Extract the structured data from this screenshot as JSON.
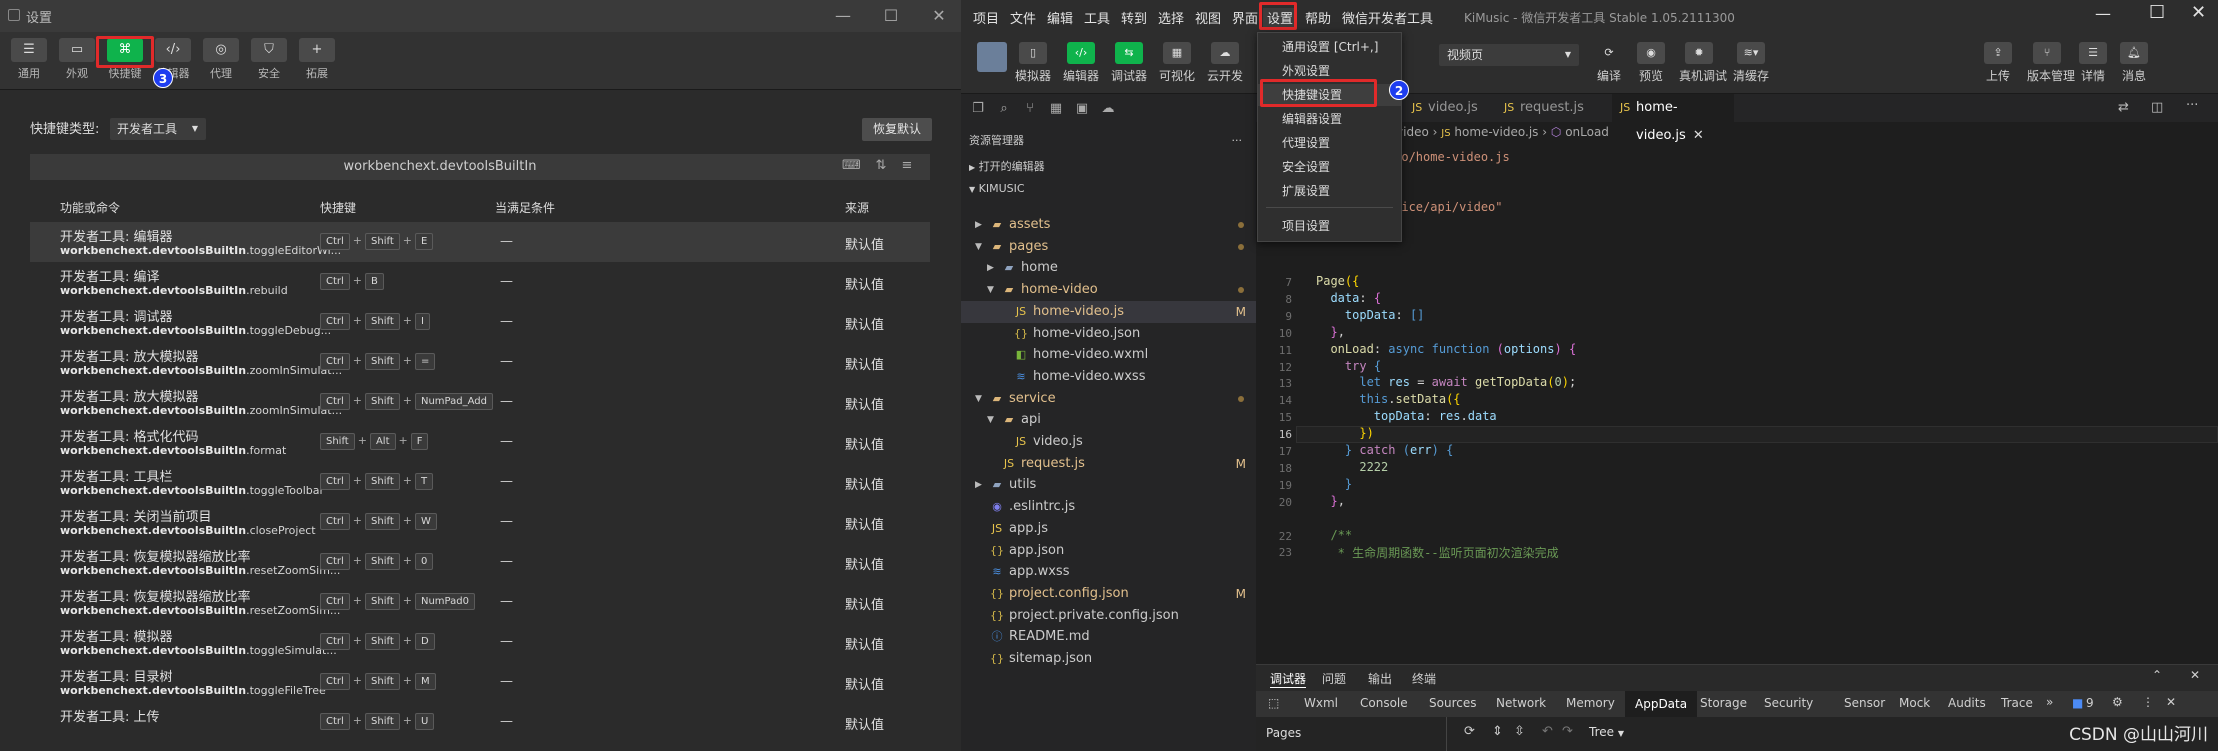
{
  "settings_window": {
    "title": "设置",
    "tabs": [
      {
        "label": "通用",
        "icon": "menu-icon"
      },
      {
        "label": "外观",
        "icon": "window-icon"
      },
      {
        "label": "快捷键",
        "icon": "command-key-icon"
      },
      {
        "label": "编辑器",
        "icon": "code-icon"
      },
      {
        "label": "代理",
        "icon": "globe-icon"
      },
      {
        "label": "安全",
        "icon": "shield-icon"
      },
      {
        "label": "拓展",
        "icon": "plus-icon"
      }
    ],
    "active_tab": "快捷键",
    "step_badge": "3",
    "shortcut_type_label": "快捷键类型:",
    "shortcut_type_value": "开发者工具",
    "restore_default": "恢复默认",
    "search_text": "workbenchext.devtoolsBuiltIn",
    "columns": [
      "功能或命令",
      "快捷键",
      "当满足条件",
      "来源"
    ],
    "rows": [
      {
        "name": "开发者工具: 编辑器",
        "cmd_bold": "workbenchext.devtoolsBuiltIn",
        "cmd_rest": ".toggleEditorWi...",
        "keys": [
          "Ctrl",
          "Shift",
          "E"
        ],
        "when": "—",
        "source": "默认值"
      },
      {
        "name": "开发者工具: 编译",
        "cmd_bold": "workbenchext.devtoolsBuiltIn",
        "cmd_rest": ".rebuild",
        "keys": [
          "Ctrl",
          "B"
        ],
        "when": "—",
        "source": "默认值"
      },
      {
        "name": "开发者工具: 调试器",
        "cmd_bold": "workbenchext.devtoolsBuiltIn",
        "cmd_rest": ".toggleDebug...",
        "keys": [
          "Ctrl",
          "Shift",
          "I"
        ],
        "when": "—",
        "source": "默认值"
      },
      {
        "name": "开发者工具: 放大模拟器",
        "cmd_bold": "workbenchext.devtoolsBuiltIn",
        "cmd_rest": ".zoomInSimulat...",
        "keys": [
          "Ctrl",
          "Shift",
          "="
        ],
        "when": "—",
        "source": "默认值"
      },
      {
        "name": "开发者工具: 放大模拟器",
        "cmd_bold": "workbenchext.devtoolsBuiltIn",
        "cmd_rest": ".zoomInSimulat...",
        "keys": [
          "Ctrl",
          "Shift",
          "NumPad_Add"
        ],
        "when": "—",
        "source": "默认值"
      },
      {
        "name": "开发者工具: 格式化代码",
        "cmd_bold": "workbenchext.devtoolsBuiltIn",
        "cmd_rest": ".format",
        "keys": [
          "Shift",
          "Alt",
          "F"
        ],
        "when": "—",
        "source": "默认值"
      },
      {
        "name": "开发者工具: 工具栏",
        "cmd_bold": "workbenchext.devtoolsBuiltIn",
        "cmd_rest": ".toggleToolbar",
        "keys": [
          "Ctrl",
          "Shift",
          "T"
        ],
        "when": "—",
        "source": "默认值"
      },
      {
        "name": "开发者工具: 关闭当前项目",
        "cmd_bold": "workbenchext.devtoolsBuiltIn",
        "cmd_rest": ".closeProject",
        "keys": [
          "Ctrl",
          "Shift",
          "W"
        ],
        "when": "—",
        "source": "默认值"
      },
      {
        "name": "开发者工具: 恢复模拟器缩放比率",
        "cmd_bold": "workbenchext.devtoolsBuiltIn",
        "cmd_rest": ".resetZoomSim...",
        "keys": [
          "Ctrl",
          "Shift",
          "0"
        ],
        "when": "—",
        "source": "默认值"
      },
      {
        "name": "开发者工具: 恢复模拟器缩放比率",
        "cmd_bold": "workbenchext.devtoolsBuiltIn",
        "cmd_rest": ".resetZoomSim...",
        "keys": [
          "Ctrl",
          "Shift",
          "NumPad0"
        ],
        "when": "—",
        "source": "默认值"
      },
      {
        "name": "开发者工具: 模拟器",
        "cmd_bold": "workbenchext.devtoolsBuiltIn",
        "cmd_rest": ".toggleSimulat...",
        "keys": [
          "Ctrl",
          "Shift",
          "D"
        ],
        "when": "—",
        "source": "默认值"
      },
      {
        "name": "开发者工具: 目录树",
        "cmd_bold": "workbenchext.devtoolsBuiltIn",
        "cmd_rest": ".toggleFileTree",
        "keys": [
          "Ctrl",
          "Shift",
          "M"
        ],
        "when": "—",
        "source": "默认值"
      },
      {
        "name": "开发者工具: 上传",
        "cmd_bold": "",
        "cmd_rest": "",
        "keys": [
          "Ctrl",
          "Shift",
          "U"
        ],
        "when": "—",
        "source": "默认值"
      }
    ]
  },
  "ide": {
    "menu": [
      "项目",
      "文件",
      "编辑",
      "工具",
      "转到",
      "选择",
      "视图",
      "界面",
      "设置",
      "帮助",
      "微信开发者工具"
    ],
    "app_title": "KiMusic - 微信开发者工具 Stable 1.05.2111300",
    "toolbar_left": [
      {
        "label": "模拟器",
        "icon": "phone-icon"
      },
      {
        "label": "编辑器",
        "icon": "code-icon"
      },
      {
        "label": "调试器",
        "icon": "debug-icon"
      },
      {
        "label": "可视化",
        "icon": "layout-icon"
      },
      {
        "label": "云开发",
        "icon": "cloud-icon"
      }
    ],
    "page_select": "视频页",
    "toolbar_mid": [
      {
        "label": "编译",
        "icon": "refresh-icon"
      },
      {
        "label": "预览",
        "icon": "eye-icon"
      },
      {
        "label": "真机调试",
        "icon": "bug-icon"
      },
      {
        "label": "清缓存",
        "icon": "layers-icon"
      }
    ],
    "toolbar_right": [
      {
        "label": "上传",
        "icon": "upload-icon"
      },
      {
        "label": "版本管理",
        "icon": "branch-icon"
      },
      {
        "label": "详情",
        "icon": "list-icon"
      },
      {
        "label": "消息",
        "icon": "bell-icon"
      }
    ],
    "settings_menu": {
      "items": [
        "通用设置 [Ctrl+,]",
        "外观设置",
        "快捷键设置",
        "编辑器设置",
        "代理设置",
        "安全设置",
        "扩展设置",
        "项目设置"
      ],
      "highlighted": "快捷键设置",
      "step_badge": "2"
    },
    "explorer": {
      "title": "资源管理器",
      "open_editors": "打开的编辑器",
      "project": "KIMUSIC",
      "tree": [
        {
          "name": "assets",
          "type": "folder",
          "depth": 1,
          "open": false,
          "dot": true
        },
        {
          "name": "pages",
          "type": "folder",
          "depth": 1,
          "open": true,
          "dot": true
        },
        {
          "name": "home",
          "type": "folder-plain",
          "depth": 2,
          "open": false
        },
        {
          "name": "home-video",
          "type": "folder",
          "depth": 2,
          "open": true,
          "dot": true
        },
        {
          "name": "home-video.js",
          "type": "js",
          "depth": 3,
          "status": "M",
          "selected": true
        },
        {
          "name": "home-video.json",
          "type": "json",
          "depth": 3
        },
        {
          "name": "home-video.wxml",
          "type": "wxml",
          "depth": 3
        },
        {
          "name": "home-video.wxss",
          "type": "wxss",
          "depth": 3
        },
        {
          "name": "service",
          "type": "folder",
          "depth": 1,
          "open": true,
          "dot": true
        },
        {
          "name": "api",
          "type": "folder",
          "depth": 2,
          "open": true
        },
        {
          "name": "video.js",
          "type": "js",
          "depth": 3
        },
        {
          "name": "request.js",
          "type": "js",
          "depth": 2,
          "status": "M"
        },
        {
          "name": "utils",
          "type": "folder-plain",
          "depth": 1,
          "open": false
        },
        {
          "name": ".eslintrc.js",
          "type": "eslint",
          "depth": 1
        },
        {
          "name": "app.js",
          "type": "js",
          "depth": 1
        },
        {
          "name": "app.json",
          "type": "json",
          "depth": 1
        },
        {
          "name": "app.wxss",
          "type": "wxss",
          "depth": 1
        },
        {
          "name": "project.config.json",
          "type": "json",
          "depth": 1,
          "status": "M"
        },
        {
          "name": "project.private.config.json",
          "type": "json",
          "depth": 1
        },
        {
          "name": "README.md",
          "type": "info",
          "depth": 1
        },
        {
          "name": "sitemap.json",
          "type": "json",
          "depth": 1
        }
      ]
    },
    "editor": {
      "tabs": [
        "video.js",
        "request.js",
        "home-video.js"
      ],
      "active_tab": "home-video.js",
      "breadcrumb": [
        "home-video",
        "home-video.js",
        "onLoad"
      ],
      "partial_path": "e-video/home-video.js",
      "import_partial": "./service/api/video\"",
      "lines": [
        {
          "no": "",
          "html": ""
        },
        {
          "no": "",
          "html": ""
        },
        {
          "no": "",
          "html": ""
        },
        {
          "no": "",
          "html": ""
        },
        {
          "no": "",
          "html": ""
        },
        {
          "no": "7",
          "html": "<span class='f'>Page</span><span class='y'>({</span>"
        },
        {
          "no": "8",
          "html": "  <span class='p'>data</span>: <span class='g'>{</span>"
        },
        {
          "no": "9",
          "html": "    <span class='p'>topData</span>: <span class='k'>[]</span>"
        },
        {
          "no": "10",
          "html": "  <span class='g'>}</span>,"
        },
        {
          "no": "11",
          "html": "  <span class='f'>onLoad</span>: <span class='k'>async</span> <span class='k'>function</span> <span class='g'>(</span><span class='p'>options</span><span class='g'>)</span> <span class='g'>{</span>"
        },
        {
          "no": "12",
          "html": "    <span class='kw'>try</span> <span class='k'>{</span>"
        },
        {
          "no": "13",
          "html": "      <span class='k'>let</span> <span class='p'>res</span> = <span class='kw'>await</span> <span class='f'>getTopData</span><span class='y'>(</span><span class='n'>0</span><span class='y'>)</span>;"
        },
        {
          "no": "14",
          "html": "      <span class='k'>this</span>.<span class='f'>setData</span><span class='y'>({</span>"
        },
        {
          "no": "15",
          "html": "        <span class='p'>topData</span>: <span class='p'>res</span>.<span class='p'>data</span>"
        },
        {
          "no": "16",
          "html": "      <span class='y'>})</span>"
        },
        {
          "no": "17",
          "html": "    <span class='k'>}</span> <span class='kw'>catch</span> <span class='k'>(</span><span class='p'>err</span><span class='k'>)</span> <span class='k'>{</span>"
        },
        {
          "no": "18",
          "html": "      <span class='n'>2222</span>"
        },
        {
          "no": "19",
          "html": "    <span class='k'>}</span>"
        },
        {
          "no": "20",
          "html": "  <span class='g'>}</span>,"
        },
        {
          "no": "",
          "html": ""
        },
        {
          "no": "22",
          "html": "  <span class='c'>/**</span>"
        },
        {
          "no": "23",
          "html": "  <span class='c'> * 生命周期函数--监听页面初次渲染完成</span>"
        }
      ],
      "current_line": "16"
    },
    "devtools": {
      "top_tabs": [
        "调试器",
        "问题",
        "输出",
        "终端"
      ],
      "panel_tabs": [
        "Wxml",
        "Console",
        "Sources",
        "Network",
        "Memory",
        "AppData",
        "Storage",
        "Security",
        "Sensor",
        "Mock",
        "Audits",
        "Trace"
      ],
      "active_panel": "AppData",
      "count": "9",
      "pages_label": "Pages",
      "tree_select": "Tree"
    },
    "watermark": "CSDN @山山河川"
  }
}
